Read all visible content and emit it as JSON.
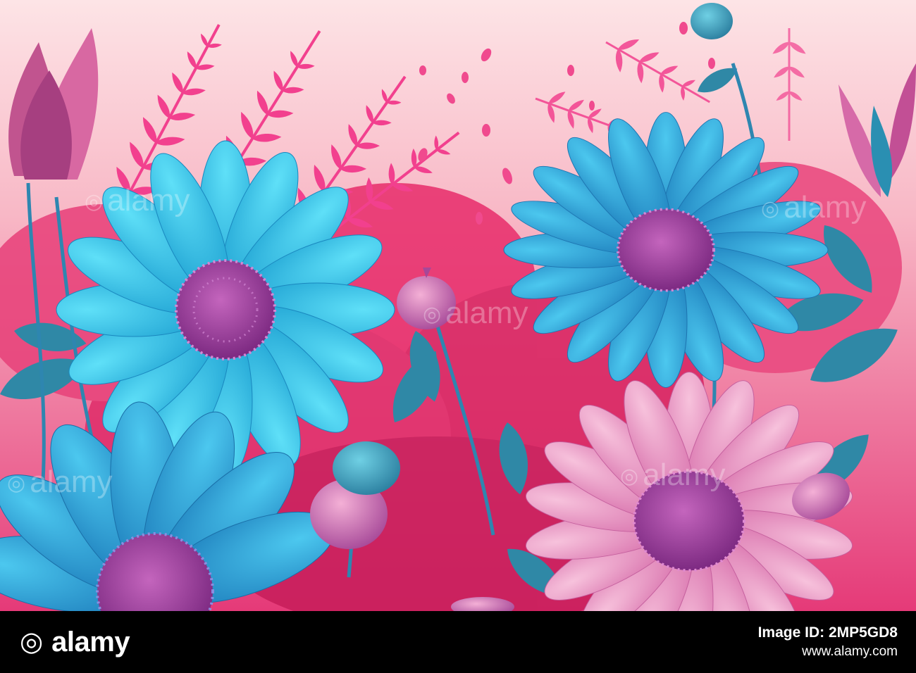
{
  "watermark": {
    "symbol": "◎",
    "text": "alamy"
  },
  "footer": {
    "brand_symbol": "◎",
    "brand_name": "alamy",
    "image_id_label": "Image ID: 2MP5GD8",
    "site_url": "www.alamy.com"
  },
  "colors": {
    "background_top": "#fde4e6",
    "background_mid": "#f8b8c6",
    "fern": "#f23d8c",
    "foliage": "#e02b6e",
    "cyan_petal": "#27c5ec",
    "blue_petal": "#2aa8d8",
    "pink_petal": "#f0a4c8",
    "flower_center": "#a0409e",
    "leaf": "#2f88a6"
  },
  "icons": [
    "alamy-logo-icon"
  ]
}
